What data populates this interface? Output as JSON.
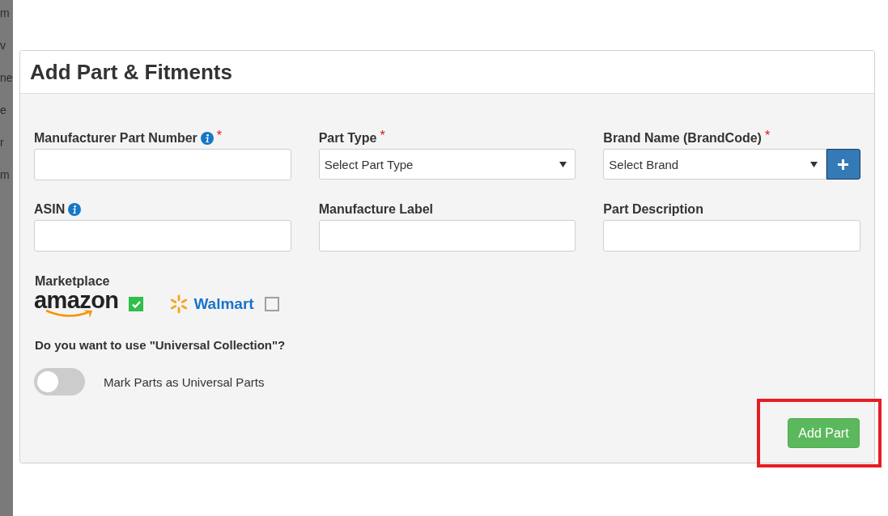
{
  "backdrop": {
    "fragments": [
      "m",
      "v",
      "ne",
      "e",
      "r",
      "m"
    ]
  },
  "modal": {
    "title": "Add Part & Fitments",
    "fields": [
      {
        "kind": "text",
        "label": "Manufacturer Part Number",
        "info": true,
        "marker": "*"
      },
      {
        "kind": "select",
        "label": "Part Type",
        "info": false,
        "marker": "*",
        "value": "Select Part Type",
        "add_button": false
      },
      {
        "kind": "select",
        "label": "Brand Name (BrandCode)",
        "info": false,
        "marker": "*",
        "value": "Select Brand",
        "add_button": true
      },
      {
        "kind": "text",
        "label": "ASIN",
        "info": true
      },
      {
        "kind": "text",
        "label": "Manufacture Label",
        "info": false
      },
      {
        "kind": "text",
        "label": "Part Description",
        "info": false
      }
    ],
    "marketplace": {
      "label": "Marketplace",
      "options": [
        {
          "kind": "smile",
          "name": "amazon",
          "checked": true
        },
        {
          "kind": "spark",
          "name": "Walmart",
          "checked": false
        }
      ]
    },
    "universal": {
      "question": "Do you want to use \"Universal Collection\"?",
      "toggle": {
        "label": "Mark Parts as Universal Parts",
        "on": false
      }
    },
    "footer": {
      "button": "Add Part",
      "highlighted": true
    }
  }
}
